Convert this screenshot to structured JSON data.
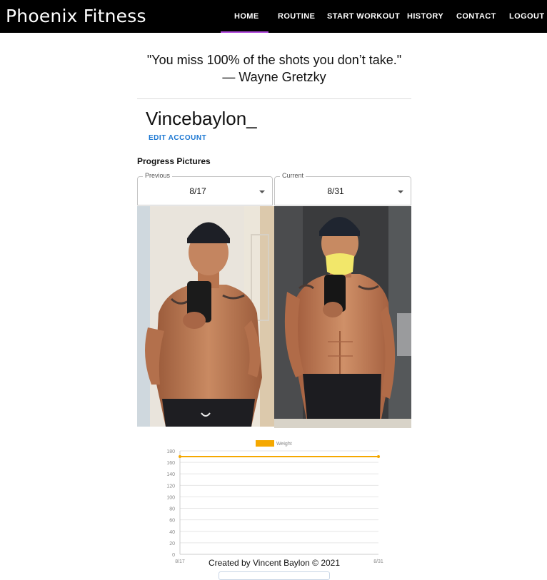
{
  "app": {
    "brand": "Phoenix Fitness"
  },
  "nav": {
    "items": [
      {
        "label": "HOME",
        "active": true
      },
      {
        "label": "ROUTINE"
      },
      {
        "label": "START WORKOUT"
      },
      {
        "label": "HISTORY"
      },
      {
        "label": "CONTACT"
      },
      {
        "label": "LOGOUT"
      }
    ],
    "active_color": "#b14bdc"
  },
  "quote": {
    "text": "\"You miss 100% of the shots you don’t take.\"",
    "author": "— Wayne Gretzky"
  },
  "profile": {
    "username": "Vincebaylon_",
    "edit_label": "EDIT ACCOUNT"
  },
  "progress": {
    "title": "Progress Pictures",
    "previous": {
      "legend": "Previous",
      "value": "8/17"
    },
    "current": {
      "legend": "Current",
      "value": "8/31"
    }
  },
  "chart_data": {
    "type": "line",
    "title": "",
    "categories": [
      "8/17",
      "8/31"
    ],
    "series": [
      {
        "name": "Weight",
        "values": [
          170,
          170
        ],
        "color": "#f5a800"
      }
    ],
    "y_ticks": [
      0,
      20,
      40,
      60,
      80,
      100,
      120,
      140,
      160,
      180
    ],
    "ylim": [
      0,
      180
    ],
    "grid": true,
    "legend": "top"
  },
  "footer": {
    "text": "Created by Vincent Baylon © 2021"
  }
}
